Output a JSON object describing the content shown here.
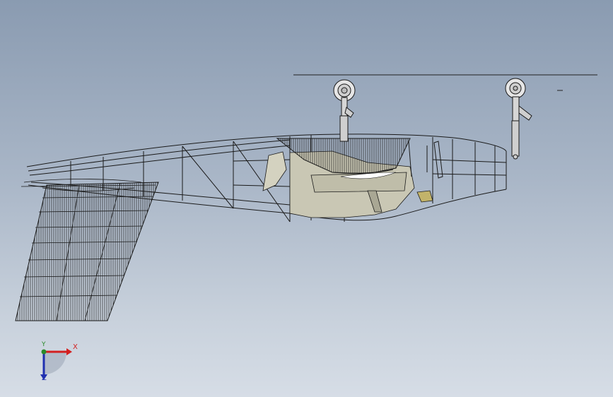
{
  "viewport": {
    "background_top": "#8a9bb1",
    "background_bottom": "#d6dde6",
    "model_line_color": "#1a1a1a",
    "model_fill_color": "#c9c7b4"
  },
  "triad": {
    "x_label": "X",
    "y_label": "Y",
    "z_label": "Z",
    "x_color": "#d32020",
    "y_color": "#2a8a2a",
    "z_color": "#2030b0"
  }
}
